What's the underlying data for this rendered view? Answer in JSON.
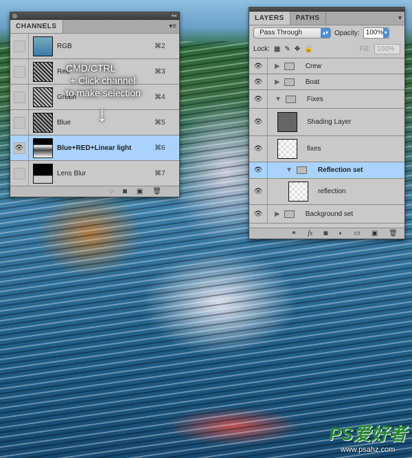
{
  "channels": {
    "tab": "CHANNELS",
    "rows": [
      {
        "label": "RGB",
        "shortcut": "⌘2",
        "visible": false
      },
      {
        "label": "Red",
        "shortcut": "⌘3",
        "visible": false
      },
      {
        "label": "Green",
        "shortcut": "⌘4",
        "visible": false
      },
      {
        "label": "Blue",
        "shortcut": "⌘5",
        "visible": false
      },
      {
        "label": "Blue+RED+Linear light",
        "shortcut": "⌘6",
        "visible": true,
        "selected": true
      },
      {
        "label": "Lens Blur",
        "shortcut": "⌘7",
        "visible": false
      }
    ],
    "footer_icons": [
      "load-selection-icon",
      "save-selection-icon",
      "new-channel-icon",
      "delete-icon"
    ]
  },
  "annotation": {
    "line1": "CMD/CTRL",
    "line2": "+ Click channel",
    "line3": "to make selection",
    "arrow": "↓"
  },
  "layers": {
    "tabs": [
      "LAYERS",
      "PATHS"
    ],
    "blend_mode": "Pass Through",
    "opacity_label": "Opacity:",
    "opacity": "100%",
    "lock_label": "Lock:",
    "fill_label": "Fill:",
    "fill": "100%",
    "rows": [
      {
        "label": "Crew",
        "type": "group",
        "expanded": false
      },
      {
        "label": "Boat",
        "type": "group",
        "expanded": false
      },
      {
        "label": "Fixes",
        "type": "group",
        "expanded": true
      },
      {
        "label": "Shading Layer",
        "type": "layer"
      },
      {
        "label": "fixes",
        "type": "layer"
      },
      {
        "label": "Reflection set",
        "type": "group",
        "expanded": true,
        "selected": true
      },
      {
        "label": "reflection",
        "type": "smart-object"
      },
      {
        "label": "Background set",
        "type": "group",
        "expanded": false
      }
    ],
    "footer_icons": [
      "link-icon",
      "fx-icon",
      "mask-icon",
      "adjustment-icon",
      "folder-icon",
      "new-layer-icon",
      "delete-icon"
    ]
  },
  "watermark": {
    "logo": "PS爱好者",
    "url": "www.psahz.com"
  }
}
